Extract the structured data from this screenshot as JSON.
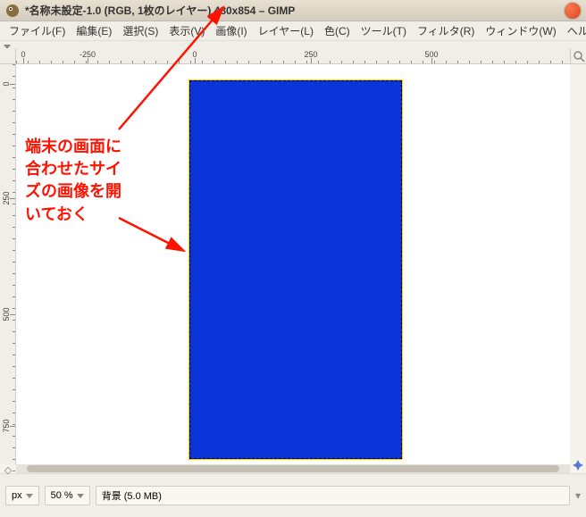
{
  "title": "*名称未設定-1.0 (RGB, 1枚のレイヤー) 480x854 – GIMP",
  "menu": {
    "file": "ファイル(F)",
    "edit": "編集(E)",
    "select": "選択(S)",
    "view": "表示(V)",
    "image": "画像(I)",
    "layer": "レイヤー(L)",
    "colors": "色(C)",
    "tools": "ツール(T)",
    "filters": "フィルタ(R)",
    "windows": "ウィンドウ(W)",
    "help": "ヘル"
  },
  "ruler_h": {
    "labels": [
      {
        "v": "0",
        "p": 8
      },
      {
        "v": "-250",
        "p": 80
      },
      {
        "v": "0",
        "p": 200
      },
      {
        "v": "250",
        "p": 330
      },
      {
        "v": "500",
        "p": 465
      }
    ]
  },
  "ruler_v": {
    "labels": [
      {
        "v": "0",
        "p": 22
      },
      {
        "v": "250",
        "p": 150
      },
      {
        "v": "500",
        "p": 280
      },
      {
        "v": "750",
        "p": 405
      }
    ]
  },
  "status": {
    "unit": "px",
    "zoom": "50 %",
    "layer_info": "背景 (5.0 MB)"
  },
  "annotation": {
    "text_l1": "端末の画面に",
    "text_l2": "合わせたサイ",
    "text_l3": "ズの画像を開",
    "text_l4": "いておく"
  }
}
